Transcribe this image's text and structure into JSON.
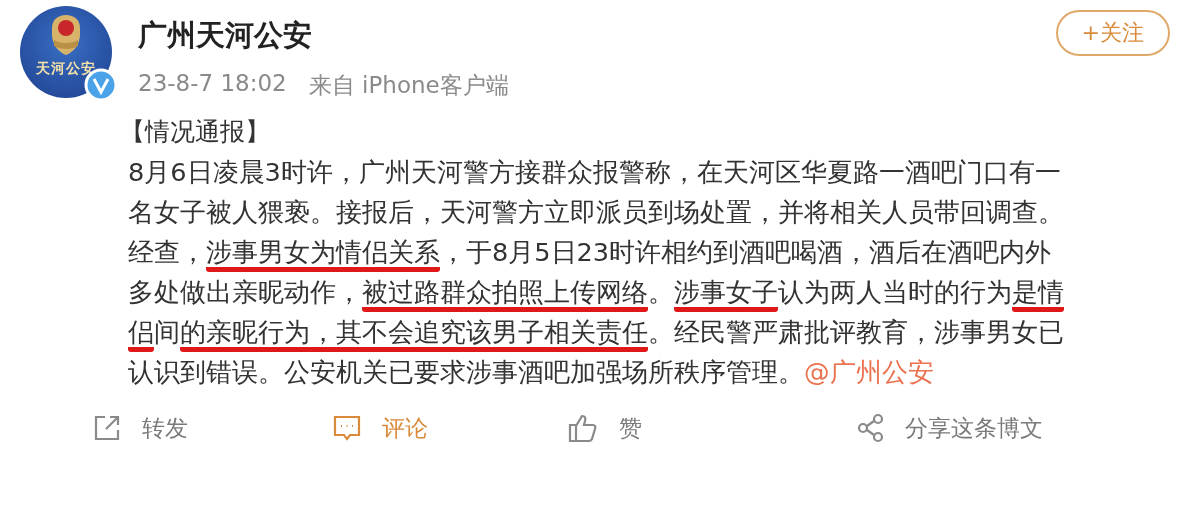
{
  "post": {
    "author": "广州天河公安",
    "avatar_text": "天河公安",
    "verified": true,
    "time": "23-8-7 18:02",
    "source": "来自 iPhone客户端",
    "follow_button": "+关注",
    "title": "【情况通报】",
    "lines": [
      [
        {
          "kind": "text",
          "text": "8月6日凌晨3时许，广州天河警方接群众报警称，在天河区华夏路一酒吧门口有一",
          "underlined": false
        }
      ],
      [
        {
          "kind": "text",
          "text": "名女子被人猥亵。接报后，天河警方立即派员到场处置，并将相关人员带回调查。",
          "underlined": false
        }
      ],
      [
        {
          "kind": "text",
          "text": "经查，",
          "underlined": false
        },
        {
          "kind": "text",
          "text": "涉事男女为情侣关系",
          "underlined": true
        },
        {
          "kind": "text",
          "text": "，于8月5日23时许相约到酒吧喝酒，酒后在酒吧内外",
          "underlined": false
        }
      ],
      [
        {
          "kind": "text",
          "text": "多处做出亲昵动作，",
          "underlined": false
        },
        {
          "kind": "text",
          "text": "被过路群众拍照上传网络",
          "underlined": true
        },
        {
          "kind": "text",
          "text": "。",
          "underlined": false
        },
        {
          "kind": "text",
          "text": "涉事女子",
          "underlined": true
        },
        {
          "kind": "text",
          "text": "认为两人当时的行为",
          "underlined": false
        },
        {
          "kind": "text",
          "text": "是情",
          "underlined": true
        }
      ],
      [
        {
          "kind": "text",
          "text": "侣",
          "underlined": true
        },
        {
          "kind": "text",
          "text": "间",
          "underlined": false
        },
        {
          "kind": "text",
          "text": "的亲昵行为，其不会追究该男子相关责任",
          "underlined": true
        },
        {
          "kind": "text",
          "text": "。经民警严肃批评教育，涉事男女已",
          "underlined": false
        }
      ],
      [
        {
          "kind": "text",
          "text": "认识到错误。公安机关已要求涉事酒吧加强场所秩序管理。",
          "underlined": false
        },
        {
          "kind": "mention",
          "text": "@广州公安",
          "underlined": false
        }
      ]
    ],
    "actions": [
      {
        "kind": "repost",
        "label": "转发",
        "selected": false
      },
      {
        "kind": "comment",
        "label": "评论",
        "selected": true
      },
      {
        "kind": "like",
        "label": "赞",
        "selected": false
      },
      {
        "kind": "share",
        "label": "分享这条博文",
        "selected": false
      }
    ]
  }
}
